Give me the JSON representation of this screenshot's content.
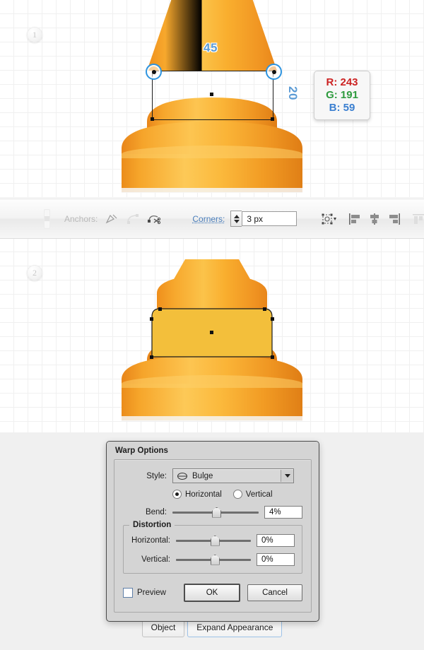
{
  "steps": [
    {
      "label": "1"
    },
    {
      "label": "2"
    }
  ],
  "canvas1": {
    "measure_width": "45",
    "measure_height": "20",
    "shape": "traffic-cone",
    "fill_hex": "#f3bf3b"
  },
  "canvas2": {
    "shape": "traffic-cone-rounded-rect"
  },
  "rgb_tooltip": {
    "r_label": "R: 243",
    "g_label": "G: 191",
    "b_label": "B: 59"
  },
  "toolbar": {
    "anchors_label": "Anchors:",
    "corners_label": "Corners:",
    "corners_value": "3 px",
    "icons": [
      "convert-anchor-point-icon",
      "smooth-anchor-point-icon",
      "cut-path-at-anchor-icon",
      "show-handles-icon",
      "align-left-icon",
      "align-center-horizontal-icon",
      "align-right-icon",
      "align-top-icon",
      "align-middle-vertical-icon"
    ]
  },
  "warp_dialog": {
    "title": "Warp Options",
    "style_label": "Style:",
    "style_value": "Bulge",
    "orientation": {
      "horizontal_label": "Horizontal",
      "vertical_label": "Vertical",
      "selected": "Horizontal"
    },
    "bend_label": "Bend:",
    "bend_value": "4%",
    "distortion_group": "Distortion",
    "distortion_horizontal_label": "Horizontal:",
    "distortion_horizontal_value": "0%",
    "distortion_vertical_label": "Vertical:",
    "distortion_vertical_value": "0%",
    "preview_label": "Preview",
    "preview_checked": false,
    "ok_label": "OK",
    "cancel_label": "Cancel"
  },
  "bottom_bar": {
    "object_label": "Object",
    "expand_appearance_label": "Expand Appearance"
  },
  "colors": {
    "accent_blue": "#5b9bd5",
    "cone_orange": "#f7a325",
    "rect_fill": "#f3bf3b",
    "link_blue": "#4a7ebb"
  }
}
